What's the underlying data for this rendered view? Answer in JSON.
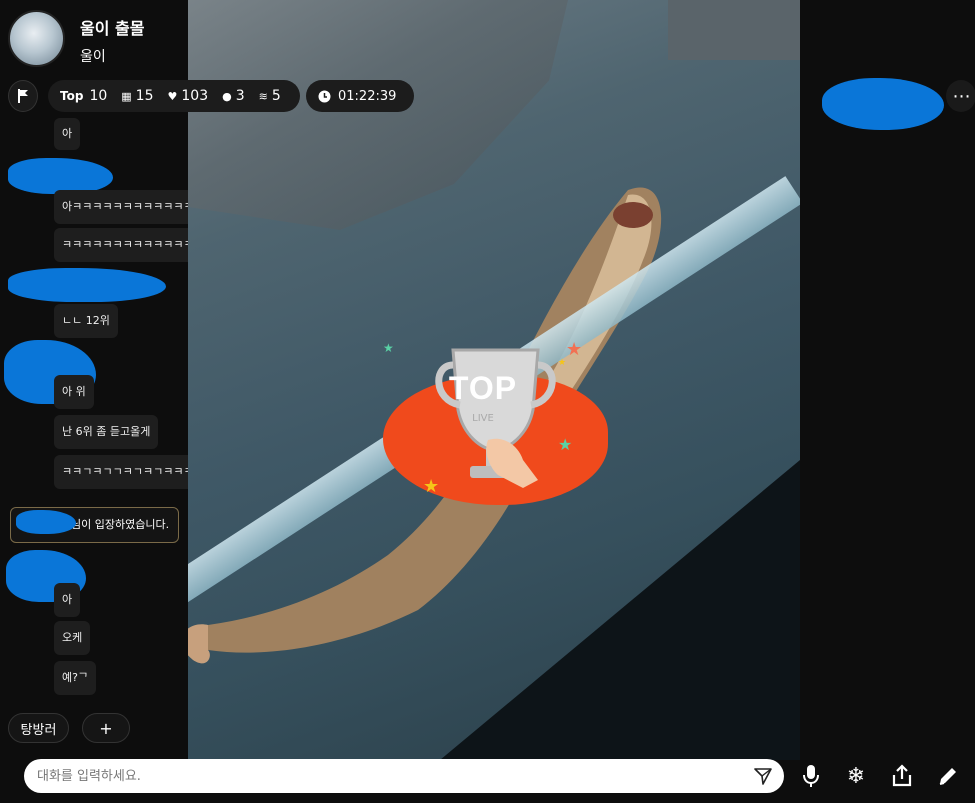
{
  "header": {
    "title": "울이 출몰",
    "subtitle": "울이"
  },
  "stats": {
    "top_label": "Top",
    "top_value": "10",
    "gift_value": "15",
    "like_value": "103",
    "viewer_value": "3",
    "layer_value": "5",
    "timer": "01:22:39"
  },
  "overlay": {
    "trophy_text": "TOP",
    "trophy_sub": "LIVE"
  },
  "chat": {
    "messages": [
      {
        "text": "아"
      },
      {
        "text": "아ㅋㅋㅋㅋㅋㅋㅋㅋㅋㅋㅋㅋㅋㅋㅋㅋㅋㅋㅋㅋㅋ"
      },
      {
        "text": "ㅋㅋㅋㅋㅋㅋㅋㅋㅋㅋㅋㅋㅋㅋㅋㅋㅋㅋ"
      },
      {
        "text": "ㄴㄴ 12위"
      },
      {
        "text": "아   위"
      },
      {
        "text": "난 6위 좀 듣고올게"
      },
      {
        "text": "ㅋㅋㄱㅋㄱㄱㅋㄱㅋㄱㅋㅋㅋㅋ"
      },
      {
        "text": "아"
      },
      {
        "text": "오케"
      },
      {
        "text": "예?ᄀ"
      }
    ],
    "entry_notice": "님이 입장하였습니다."
  },
  "buttons": {
    "exit_label": "탕방러",
    "add_label": "+"
  },
  "input": {
    "placeholder": "대화를 입력하세요."
  },
  "icons": {
    "flag": "flag-icon",
    "gift": "gift-icon",
    "heart": "heart-icon",
    "viewer": "person-icon",
    "layers": "layers-icon",
    "clock": "clock-icon",
    "send": "send-icon",
    "mic": "mic-icon",
    "freeze": "snowflake-icon",
    "share": "share-icon",
    "edit": "pencil-icon",
    "more": "more-icon"
  },
  "colors": {
    "redaction": "#0a76d8",
    "trophy_bg": "#f04a1c",
    "notice_border": "#7a6a48"
  }
}
